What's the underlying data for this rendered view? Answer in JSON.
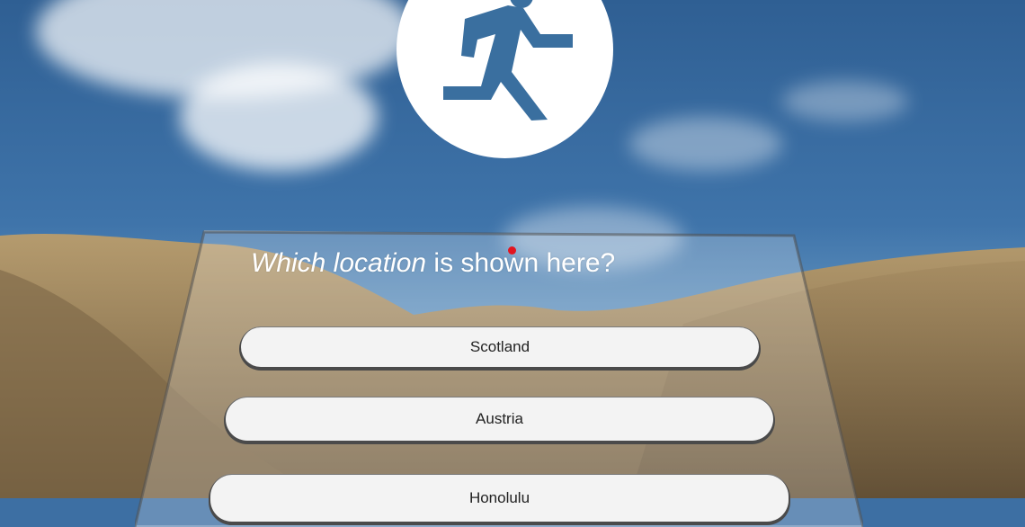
{
  "quiz": {
    "question_emphasis": "Which location",
    "question_rest": " is shown here?",
    "answers": [
      "Scotland",
      "Austria",
      "Honolulu"
    ]
  },
  "icons": {
    "exit": "running-man-exit-icon",
    "reticle": "gaze-reticle-dot"
  },
  "colors": {
    "reticle": "#e3141f",
    "icon": "#3a6f9f",
    "button_bg": "#f3f3f3"
  }
}
